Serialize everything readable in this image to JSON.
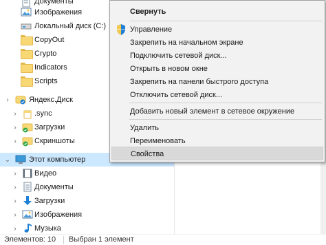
{
  "nav": {
    "documents": "Документы",
    "images": "Изображения",
    "local_disk": "Локальный диск (C:)",
    "copyout": "CopyOut",
    "crypto": "Crypto",
    "indicators": "Indicators",
    "scripts": "Scripts",
    "yandex_disk": "Яндекс.Диск",
    "sync": ".sync",
    "downloads": "Загрузки",
    "screenshots": "Скриншоты",
    "this_pc": "Этот компьютер",
    "video": "Видео",
    "pc_documents": "Документы",
    "pc_downloads": "Загрузки",
    "pc_images": "Изображения",
    "music": "Музыка"
  },
  "menu": {
    "collapse": "Свернуть",
    "manage": "Управление",
    "pin_start": "Закрепить на начальном экране",
    "map_drive": "Подключить сетевой диск...",
    "open_new_window": "Открыть в новом окне",
    "pin_quick_access": "Закрепить на панели быстрого доступа",
    "disconnect_drive": "Отключить сетевой диск...",
    "add_network_location": "Добавить новый элемент в сетевое окружение",
    "delete": "Удалить",
    "rename": "Переименовать",
    "properties": "Свойства"
  },
  "status": {
    "items": "Элементов: 10",
    "selected": "Выбран 1 элемент"
  },
  "colors": {
    "selection": "#cce8ff",
    "menu_bg": "#f2f2f2",
    "folder": "#f8d775",
    "accent_blue": "#1e7fd6"
  }
}
